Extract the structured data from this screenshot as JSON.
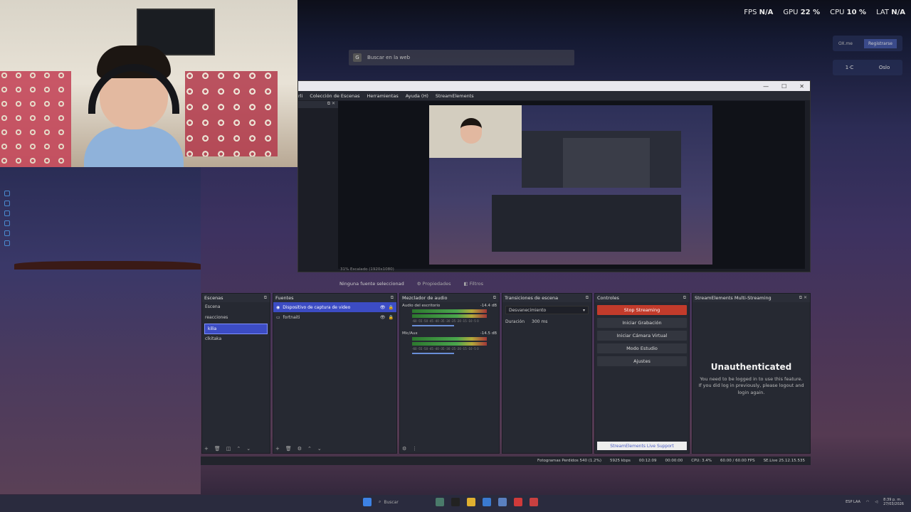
{
  "overlay_stats": {
    "fps_label": "FPS",
    "fps_value": "N/A",
    "gpu_label": "GPU",
    "gpu_value": "22 %",
    "cpu_label": "CPU",
    "cpu_value": "10 %",
    "lat_label": "LAT",
    "lat_value": "N/A"
  },
  "browser": {
    "search_placeholder": "Buscar en la web",
    "g_letter": "G"
  },
  "widgets": {
    "w1_left": "OX.me",
    "w1_right": "Registrarse",
    "w2_temp": "1·C",
    "w2_city": "Oslo"
  },
  "obs": {
    "title_controls": [
      "—",
      "☐",
      "✕"
    ],
    "menu": [
      "rli",
      "Colección de Escenas",
      "Herramientas",
      "Ayuda (H)",
      "StreamElements"
    ],
    "preview_footer": "31%   Escalado (1920x1080)",
    "no_source": "Ninguna fuente seleccionad",
    "properties": "Propiedades",
    "filters": "Filtros"
  },
  "docks": {
    "scenes": {
      "title": "Escenas",
      "items": [
        "Escena",
        "reacciones",
        "kilia",
        "clkitaka"
      ],
      "active_index": 2
    },
    "sources": {
      "title": "Fuentes",
      "items": [
        "Dispositivo de captura de video",
        "fortnaiti"
      ],
      "active_index": 0
    },
    "mixer": {
      "title": "Mezclador de audio",
      "channels": [
        {
          "name": "Audio del escritorio",
          "db": "-14.4 dB"
        },
        {
          "name": "Mic/Aux",
          "db": "-14.5 dB"
        }
      ],
      "scale": "-60 -55 -50 -45 -40 -35 -30 -25 -20 -15 -10 -5 0"
    },
    "transitions": {
      "title": "Transiciones de escena",
      "selected": "Desvanecimiento",
      "duration_label": "Duración",
      "duration_value": "300 ms"
    },
    "controls": {
      "title": "Controles",
      "buttons": [
        "Stop Streaming",
        "Iniciar Grabación",
        "Iniciar Cámara Virtual",
        "Modo Estudio",
        "Ajustes"
      ]
    },
    "streamelements": {
      "title": "StreamElements Multi-Streaming",
      "heading": "Unauthenticated",
      "message": "You need to be logged in to use this feature. If you did log in previously, please logout and login again.",
      "support": "StreamElements Live Support"
    }
  },
  "statusbar": {
    "dropped": "Fotogramas Perdidos 540 (1.2%)",
    "bitrate": "5925 kbps",
    "live_time": "00:12:09",
    "rec_time": "00:00:00",
    "cpu": "CPU: 3.4%",
    "fps": "60.00 / 60.00 FPS",
    "version": "SE.Live 25.12.15.535"
  },
  "taskbar": {
    "search": "Buscar",
    "lang": "ESP LAA",
    "time": "8:39 p. m.",
    "date": "27/03/2026"
  }
}
